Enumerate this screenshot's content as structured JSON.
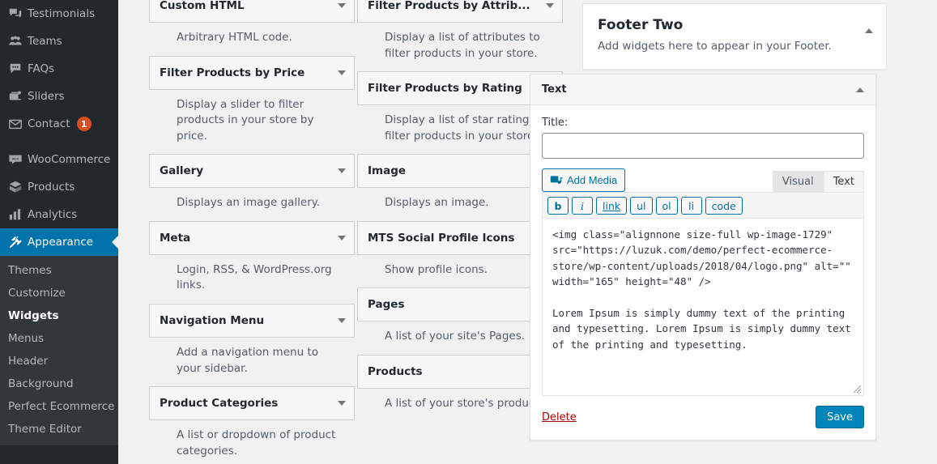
{
  "sidebar": {
    "top_items": [
      {
        "label": "Testimonials",
        "icon": "testimonials-icon",
        "badge": null,
        "current": false,
        "separator_before": false
      },
      {
        "label": "Teams",
        "icon": "teams-icon",
        "badge": null,
        "current": false,
        "separator_before": false
      },
      {
        "label": "FAQs",
        "icon": "faqs-icon",
        "badge": null,
        "current": false,
        "separator_before": false
      },
      {
        "label": "Sliders",
        "icon": "sliders-icon",
        "badge": null,
        "current": false,
        "separator_before": false
      },
      {
        "label": "Contact",
        "icon": "contact-icon",
        "badge": "1",
        "current": false,
        "separator_before": false
      },
      {
        "label": "WooCommerce",
        "icon": "woocommerce-icon",
        "badge": null,
        "current": false,
        "separator_before": true
      },
      {
        "label": "Products",
        "icon": "products-icon",
        "badge": null,
        "current": false,
        "separator_before": false
      },
      {
        "label": "Analytics",
        "icon": "analytics-icon",
        "badge": null,
        "current": false,
        "separator_before": false
      },
      {
        "label": "Appearance",
        "icon": "appearance-icon",
        "badge": null,
        "current": true,
        "separator_before": false
      }
    ],
    "submenu": [
      {
        "label": "Themes",
        "current": false
      },
      {
        "label": "Customize",
        "current": false
      },
      {
        "label": "Widgets",
        "current": true
      },
      {
        "label": "Menus",
        "current": false
      },
      {
        "label": "Header",
        "current": false
      },
      {
        "label": "Background",
        "current": false
      },
      {
        "label": "Perfect Ecommerce",
        "current": false
      },
      {
        "label": "Theme Editor",
        "current": false
      }
    ]
  },
  "available_widgets": {
    "column1": [
      {
        "title": "Custom HTML",
        "description": "Arbitrary HTML code."
      },
      {
        "title": "Filter Products by Price",
        "description": "Display a slider to filter products in your store by price."
      },
      {
        "title": "Gallery",
        "description": "Displays an image gallery."
      },
      {
        "title": "Meta",
        "description": "Login, RSS, & WordPress.org links."
      },
      {
        "title": "Navigation Menu",
        "description": "Add a navigation menu to your sidebar."
      },
      {
        "title": "Product Categories",
        "description": "A list or dropdown of product categories."
      }
    ],
    "column2": [
      {
        "title": "Filter Products by Attrib...",
        "description": "Display a list of attributes to filter products in your store."
      },
      {
        "title": "Filter Products by Rating",
        "description": "Display a list of star ratings to filter products in your store."
      },
      {
        "title": "Image",
        "description": "Displays an image."
      },
      {
        "title": "MTS Social Profile Icons",
        "description": "Show profile icons."
      },
      {
        "title": "Pages",
        "description": "A list of your site's Pages."
      },
      {
        "title": "Products",
        "description": "A list of your store's products."
      }
    ]
  },
  "sidebar_panel": {
    "title": "Footer Two",
    "description": "Add widgets here to appear in your Footer."
  },
  "text_widget": {
    "header_title": "Text",
    "title_label": "Title:",
    "title_value": "",
    "title_placeholder": "",
    "add_media_label": "Add Media",
    "tabs": [
      {
        "label": "Visual",
        "active": false
      },
      {
        "label": "Text",
        "active": true
      }
    ],
    "quicktags": [
      "b",
      "i",
      "link",
      "ul",
      "ol",
      "li",
      "code"
    ],
    "content": "<img class=\"alignnone size-full wp-image-1729\" src=\"https://luzuk.com/demo/perfect-ecommerce-store/wp-content/uploads/2018/04/logo.png\" alt=\"\" width=\"165\" height=\"48\" />\n\nLorem Ipsum is simply dummy text of the printing and typesetting. Lorem Ipsum is simply dummy text of the printing and typesetting.",
    "delete_label": "Delete",
    "save_label": "Save"
  },
  "colors": {
    "admin_bg": "#23282d",
    "submenu_bg": "#32373c",
    "accent_blue": "#0073aa",
    "save_blue": "#0085ba",
    "badge_orange": "#d54e21",
    "delete_red": "#aa0000",
    "page_bg": "#f1f1f1"
  }
}
